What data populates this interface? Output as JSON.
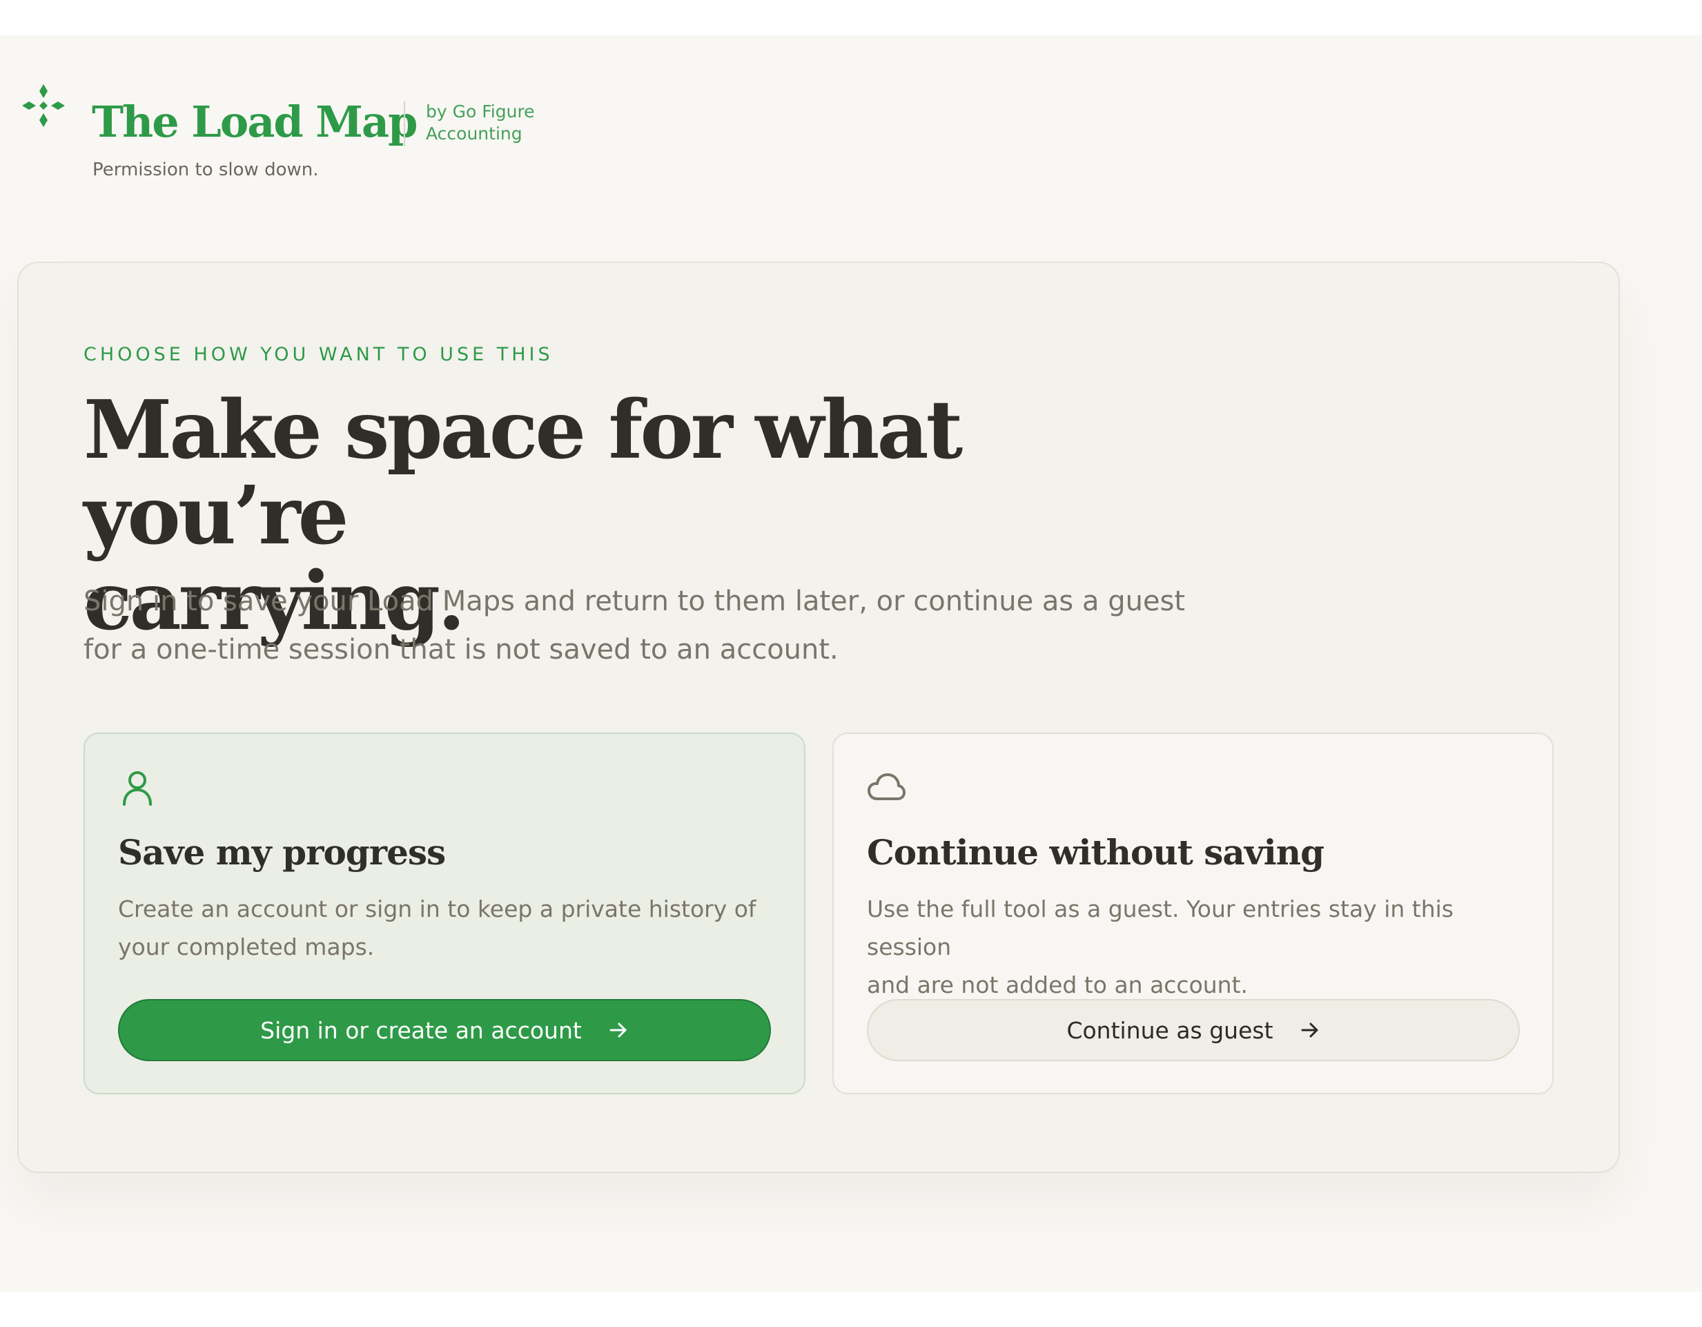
{
  "brand": {
    "title": "The Load Map",
    "by_line_1": "by Go Figure",
    "by_line_2": "Accounting",
    "tagline": "Permission to slow down.",
    "accent_color": "#2e9a48",
    "logo_icon": "four-diamond-sparkle-icon"
  },
  "intro": {
    "eyebrow": "CHOOSE HOW YOU WANT TO USE THIS",
    "headline_line_1": "Make space for what you’re",
    "headline_line_2": "carrying.",
    "subtitle_line_1": "Sign in to save your Load Maps and return to them later, or continue as a guest",
    "subtitle_line_2": "for a one-time session that is not saved to an account."
  },
  "options": {
    "save": {
      "icon": "user-icon",
      "title": "Save my progress",
      "description_line_1": "Create an account or sign in to keep a private history of",
      "description_line_2": "your completed maps.",
      "button_label": "Sign in or create an account"
    },
    "guest": {
      "icon": "cloud-icon",
      "title": "Continue without saving",
      "description_line_1": "Use the full tool as a guest. Your entries stay in this session",
      "description_line_2": "and are not added to an account.",
      "button_label": "Continue as guest"
    }
  }
}
